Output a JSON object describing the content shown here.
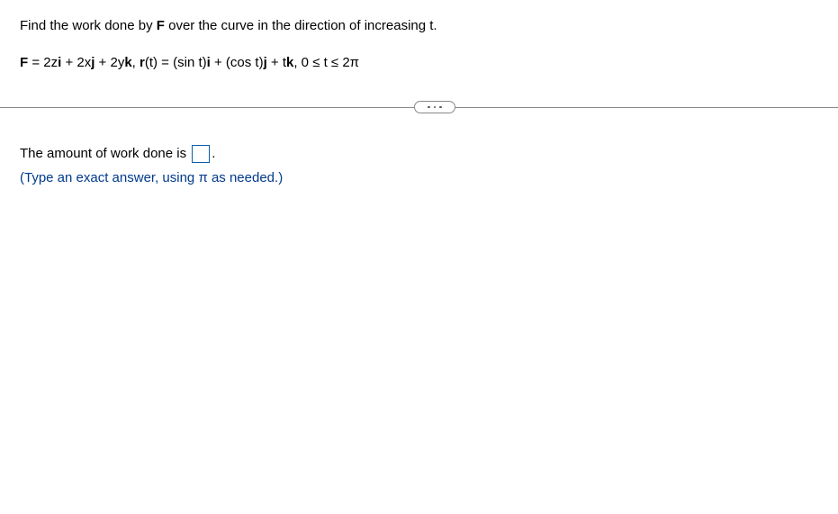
{
  "question": {
    "instruction_pre": "Find the work done by ",
    "instruction_bold": "F",
    "instruction_post": " over the curve in the direction of increasing t."
  },
  "formula": {
    "f_label": "F",
    "f_eq": " = 2z",
    "f_i": "i",
    "f_plus1": " + 2x",
    "f_j": "j",
    "f_plus2": " + 2y",
    "f_k": "k",
    "comma": ", ",
    "r_label": "r",
    "r_arg": "(t) = (sin t)",
    "r_i": "i",
    "r_plus1": " + (cos t)",
    "r_j": "j",
    "r_plus2": " + t",
    "r_k": "k",
    "range": ", 0 ≤ t ≤ 2π"
  },
  "answer": {
    "prefix": "The amount of work done is ",
    "suffix": ".",
    "hint": "(Type an exact answer, using π as needed.)"
  }
}
